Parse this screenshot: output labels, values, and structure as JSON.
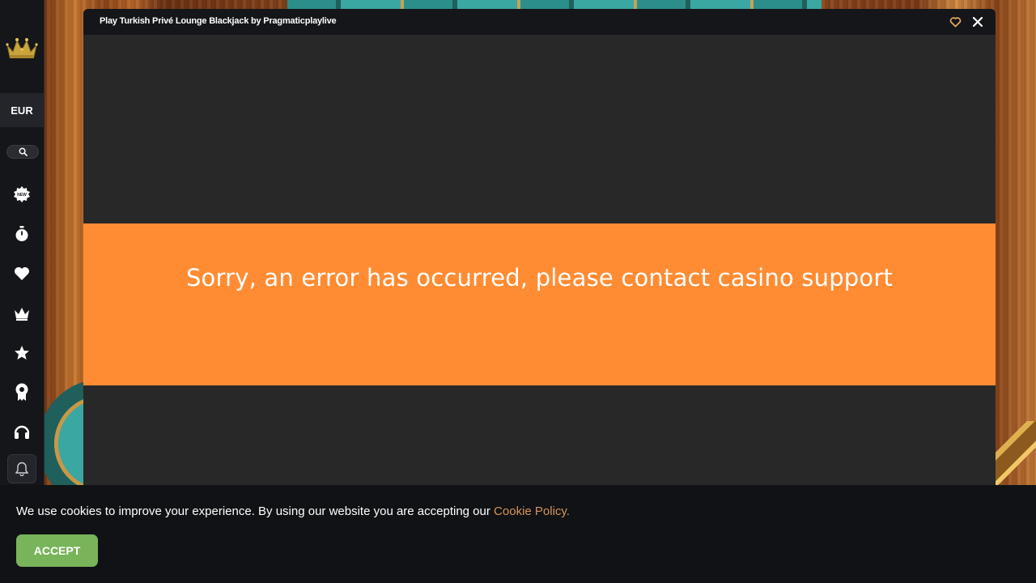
{
  "sidebar": {
    "currency": "EUR",
    "icons": [
      "new-games-icon",
      "timer-icon",
      "heart-icon",
      "crown-icon",
      "star-icon",
      "award-icon",
      "headset-icon",
      "bell-icon"
    ]
  },
  "modal": {
    "title": "Play Turkish Privé Lounge Blackjack by Pragmaticplaylive",
    "error_message": "Sorry, an error has occurred, please contact casino support",
    "accent_color": "#ff8c33"
  },
  "cookie": {
    "message": "We use cookies to improve your experience. By using our website you are accepting our ",
    "link_text": "Cookie Policy.",
    "accept_label": "ACCEPT",
    "accept_color": "#78b45a"
  }
}
